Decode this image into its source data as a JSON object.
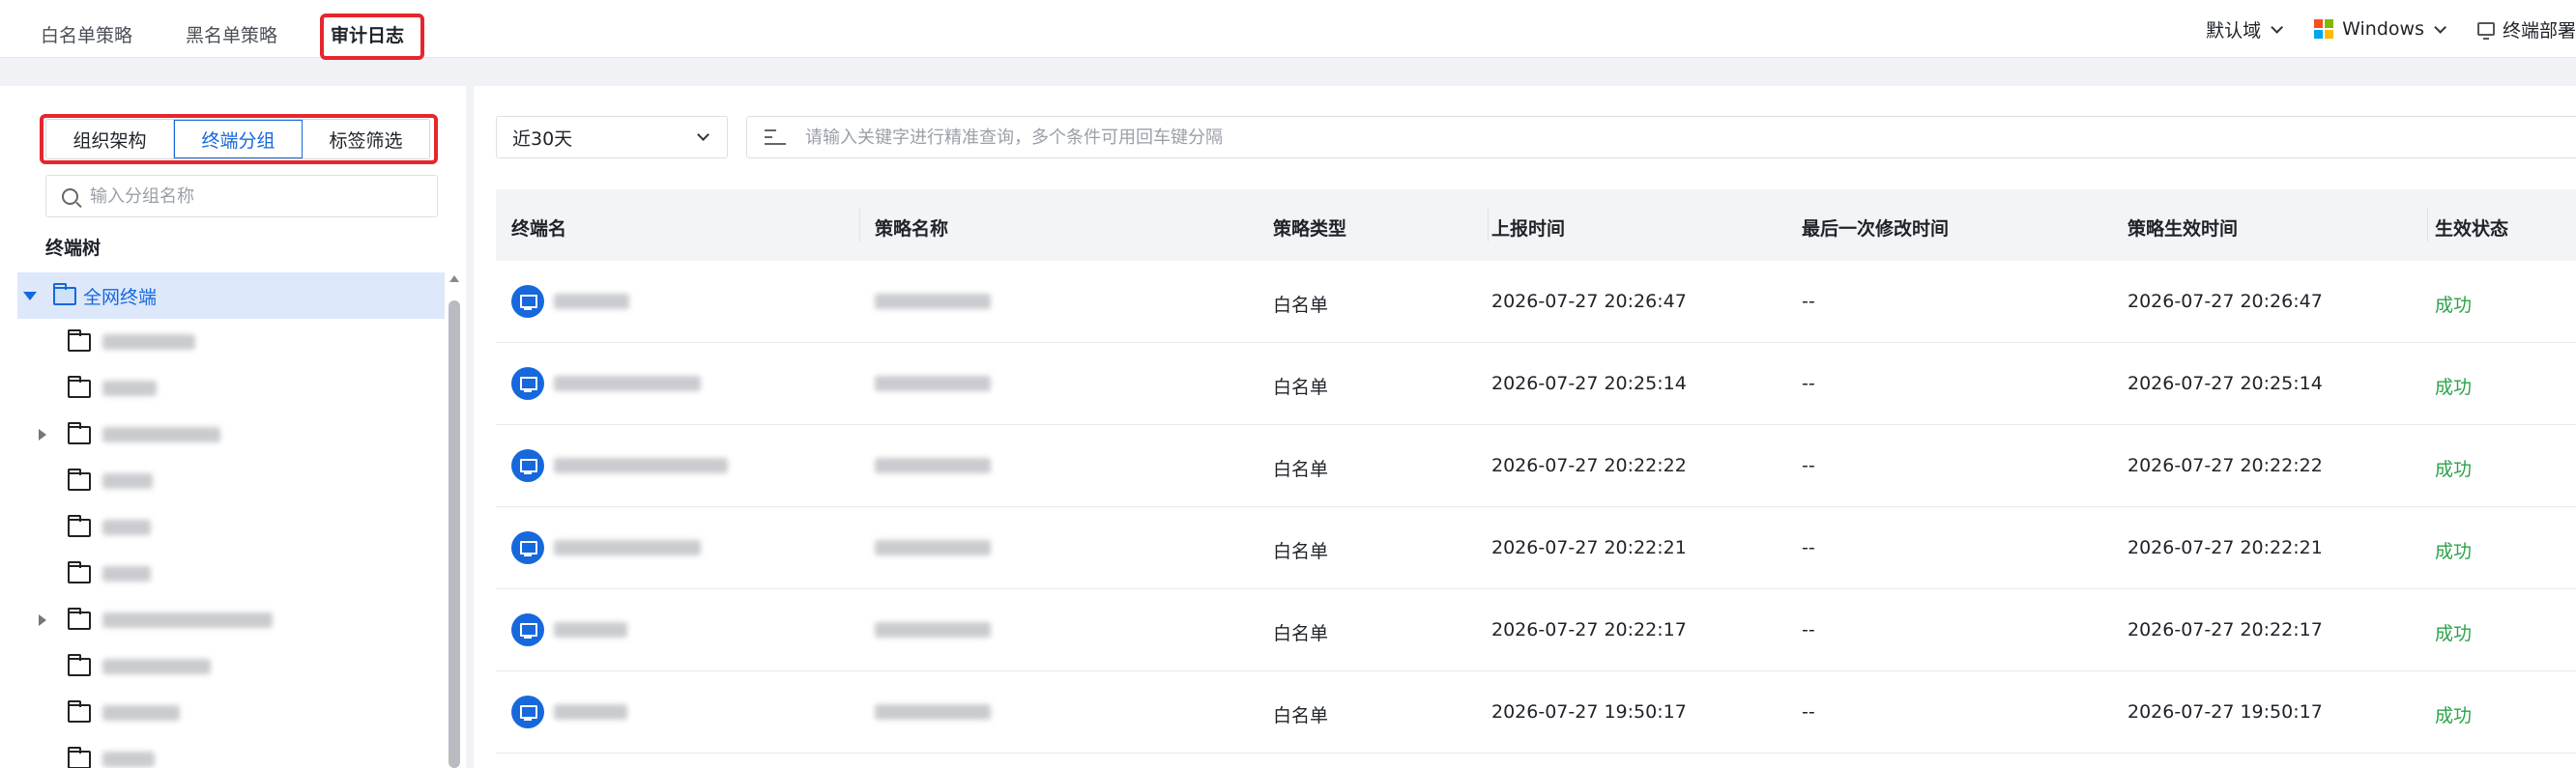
{
  "tabs": [
    {
      "label": "白名单策略"
    },
    {
      "label": "黑名单策略"
    },
    {
      "label": "审计日志"
    }
  ],
  "header_tools": {
    "domain": "默认域",
    "os": "Windows",
    "deploy": "终端部署"
  },
  "colors": {
    "accent": "#1668dc",
    "highlight_box": "#e6262d",
    "success": "#2ba34a",
    "windows": [
      "#f25022",
      "#7fba00",
      "#00a4ef",
      "#ffb900"
    ]
  },
  "left": {
    "segments": [
      "组织架构",
      "终端分组",
      "标签筛选"
    ],
    "active_segment": "终端分组",
    "search_placeholder": "输入分组名称",
    "tree_title": "终端树",
    "root_label": "全网终端"
  },
  "filters": {
    "range": "近30天",
    "keyword_placeholder": "请输入关键字进行精准查询，多个条件可用回车键分隔"
  },
  "table": {
    "columns": [
      "终端名",
      "策略名称",
      "策略类型",
      "上报时间",
      "最后一次修改时间",
      "策略生效时间",
      "生效状态"
    ],
    "rows": [
      {
        "type": "白名单",
        "report": "2026-07-27 20:26:47",
        "modified": "--",
        "effective": "2026-07-27 20:26:47",
        "status": "成功"
      },
      {
        "type": "白名单",
        "report": "2026-07-27 20:25:14",
        "modified": "--",
        "effective": "2026-07-27 20:25:14",
        "status": "成功"
      },
      {
        "type": "白名单",
        "report": "2026-07-27 20:22:22",
        "modified": "--",
        "effective": "2026-07-27 20:22:22",
        "status": "成功"
      },
      {
        "type": "白名单",
        "report": "2026-07-27 20:22:21",
        "modified": "--",
        "effective": "2026-07-27 20:22:21",
        "status": "成功"
      },
      {
        "type": "白名单",
        "report": "2026-07-27 20:22:17",
        "modified": "--",
        "effective": "2026-07-27 20:22:17",
        "status": "成功"
      },
      {
        "type": "白名单",
        "report": "2026-07-27 19:50:17",
        "modified": "--",
        "effective": "2026-07-27 19:50:17",
        "status": "成功"
      }
    ]
  }
}
